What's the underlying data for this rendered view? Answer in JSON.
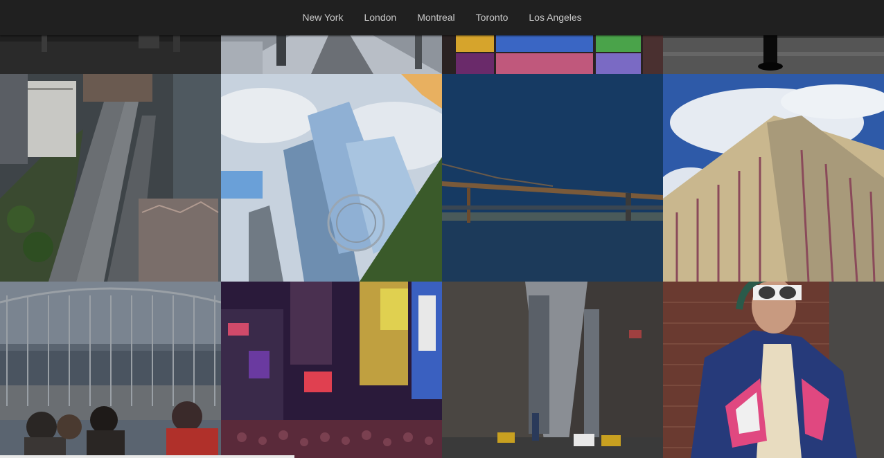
{
  "nav": {
    "items": [
      {
        "label": "New York"
      },
      {
        "label": "London"
      },
      {
        "label": "Montreal"
      },
      {
        "label": "Toronto"
      },
      {
        "label": "Los Angeles"
      }
    ]
  },
  "colors": {
    "navbar_bg": "#202020",
    "nav_text": "#c9c9c9"
  }
}
